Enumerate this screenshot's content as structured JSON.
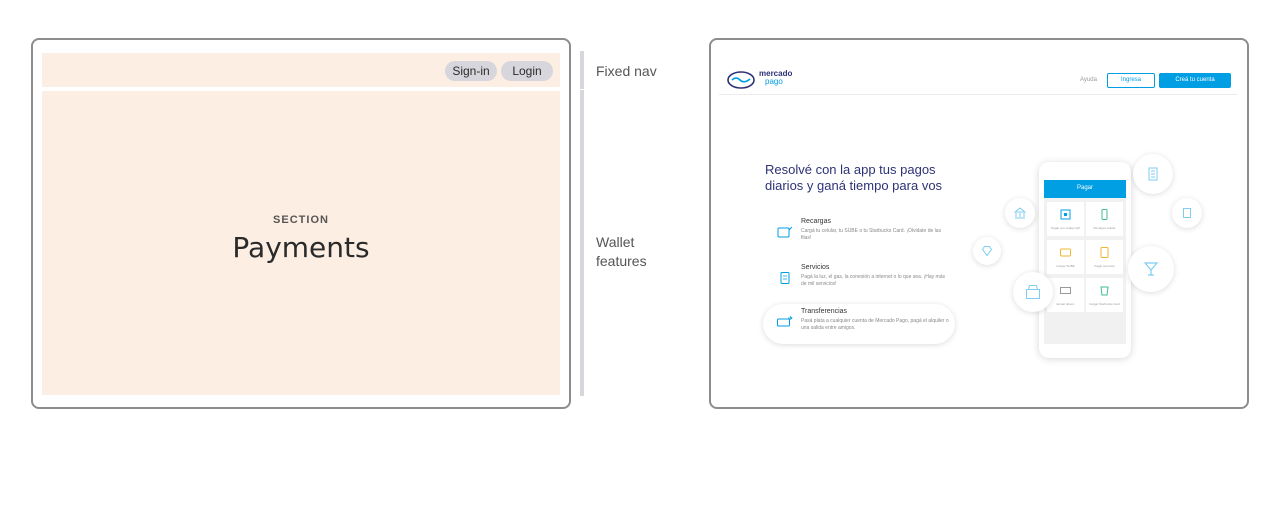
{
  "wireframe": {
    "nav": {
      "signin_label": "Sign-in",
      "login_label": "Login"
    },
    "section": {
      "kicker": "SECTION",
      "title": "Payments"
    },
    "colors": {
      "block": "#fdeee4",
      "button": "#d6d6dc",
      "border": "#8d8d8f"
    }
  },
  "annotations": {
    "nav_label": "Fixed nav",
    "main_label_line1": "Wallet",
    "main_label_line2": "features"
  },
  "mockup": {
    "brand": {
      "name_line1": "mercado",
      "name_line2": "pago",
      "logo_icon": "handshake-icon"
    },
    "header": {
      "help_link": "Ayuda",
      "login_button": "Ingresa",
      "signup_button": "Creá tu cuenta"
    },
    "hero": {
      "title": "Resolvé con la app tus pagos diarios y ganá tiempo para vos"
    },
    "features": [
      {
        "title": "Recargas",
        "desc": "Cargá tu celular, tu SUBE o tu Starbucks Card. ¡Olvidate de las filas!",
        "icon": "phone-reload-icon"
      },
      {
        "title": "Servicios",
        "desc": "Pagá la luz, el gas, la conexión a internet o lo que sea. ¡Hay más de mil servicios!",
        "icon": "receipt-icon"
      },
      {
        "title": "Transferencias",
        "desc": "Pasá plata a cualquier cuenta de Mercado Pago, pagá el alquiler o una salida entre amigos.",
        "icon": "money-transfer-icon"
      }
    ],
    "phone": {
      "title": "Pagar",
      "cells": [
        "Pagar con código QR",
        "Recargar celular",
        "Cargar SUBE",
        "Pagar servicios",
        "Enviar dinero",
        "Cargar Starbucks Card"
      ]
    },
    "colors": {
      "brand_blue": "#009ee3",
      "brand_navy": "#2d3277"
    }
  }
}
